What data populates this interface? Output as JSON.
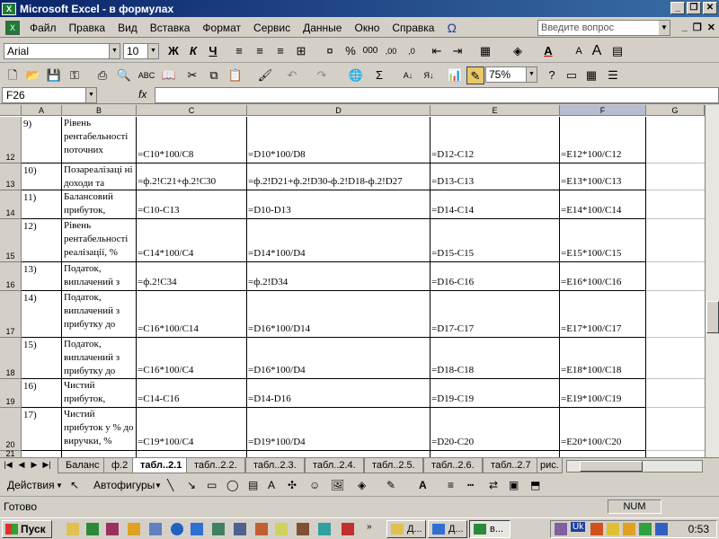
{
  "window": {
    "title": "Microsoft Excel - в формулах"
  },
  "menu": {
    "items": [
      "Файл",
      "Правка",
      "Вид",
      "Вставка",
      "Формат",
      "Сервис",
      "Данные",
      "Окно",
      "Справка"
    ],
    "help_placeholder": "Введите вопрос"
  },
  "format_toolbar": {
    "font": "Arial",
    "size": "10",
    "zoom": "75%"
  },
  "formula_bar": {
    "cell_ref": "F26",
    "fx": "fx",
    "formula": ""
  },
  "columns": [
    "A",
    "B",
    "C",
    "D",
    "E",
    "F",
    "G"
  ],
  "selected_column": "F",
  "rows": [
    {
      "num": "12",
      "a": "9)",
      "b": "Рівень рентабельності поточних",
      "c": "=C10*100/C8",
      "d": "=D10*100/D8",
      "e": "=D12-C12",
      "f": "=E12*100/C12"
    },
    {
      "num": "13",
      "a": "10)",
      "b": "Позареалізаці ні доходи та",
      "c": "=ф.2!C21+ф.2!C30",
      "d": "=ф.2!D21+ф.2!D30-ф.2!D18-ф.2!D27",
      "e": "=D13-C13",
      "f": "=E13*100/C13"
    },
    {
      "num": "14",
      "a": "11)",
      "b": "Балансовий прибуток,",
      "c": "=C10-C13",
      "d": "=D10-D13",
      "e": "=D14-C14",
      "f": "=E14*100/C14"
    },
    {
      "num": "15",
      "a": "12)",
      "b": "Рівень рентабельності реалізації, %",
      "c": "=C14*100/C4",
      "d": "=D14*100/D4",
      "e": "=D15-C15",
      "f": "=E15*100/C15"
    },
    {
      "num": "16",
      "a": "13)",
      "b": "Податок, виплачений з",
      "c": "=ф.2!C34",
      "d": "=ф.2!D34",
      "e": "=D16-C16",
      "f": "=E16*100/C16"
    },
    {
      "num": "17",
      "a": "14)",
      "b": "Податок, виплачений з прибутку до",
      "c": "=C16*100/C14",
      "d": "=D16*100/D14",
      "e": "=D17-C17",
      "f": "=E17*100/C17"
    },
    {
      "num": "18",
      "a": "15)",
      "b": "Податок, виплачений з прибутку до",
      "c": "=C16*100/C4",
      "d": "=D16*100/D4",
      "e": "=D18-C18",
      "f": "=E18*100/C18"
    },
    {
      "num": "19",
      "a": "16)",
      "b": "Чистий прибуток,",
      "c": "=C14-C16",
      "d": "=D14-D16",
      "e": "=D19-C19",
      "f": "=E19*100/C19"
    },
    {
      "num": "20",
      "a": "17)",
      "b": "Чистий прибуток у % до виручки, %",
      "c": "=C19*100/C4",
      "d": "=D19*100/D4",
      "e": "=D20-C20",
      "f": "=E20*100/C20"
    },
    {
      "num": "21",
      "a": "",
      "b": "",
      "c": "",
      "d": "",
      "e": "",
      "f": ""
    }
  ],
  "sheet_tabs": [
    "Баланс",
    "ф.2",
    "табл..2.1",
    "табл..2.2.",
    "табл..2.3.",
    "табл..2.4.",
    "табл..2.5.",
    "табл..2.6.",
    "табл..2.7",
    "рис."
  ],
  "active_tab": "табл..2.1",
  "drawing_toolbar": {
    "actions": "Действия",
    "autoshapes": "Автофигуры"
  },
  "status": {
    "ready": "Готово",
    "num": "NUM"
  },
  "taskbar": {
    "start": "Пуск",
    "tasks": [
      "Д...",
      "Д...",
      "в..."
    ],
    "tray_lang": "Uk",
    "clock": "0:53"
  }
}
